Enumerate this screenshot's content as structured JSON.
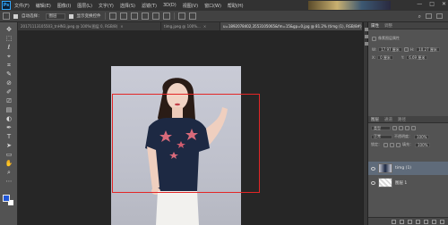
{
  "app": {
    "logo": "Ps"
  },
  "menu": {
    "items": [
      "文件(F)",
      "编辑(E)",
      "图像(I)",
      "图层(L)",
      "文字(Y)",
      "选择(S)",
      "滤镜(T)",
      "3D(D)",
      "视图(V)",
      "窗口(W)",
      "帮助(H)"
    ],
    "window_controls": [
      "—",
      "□",
      "✕"
    ]
  },
  "options": {
    "auto_select_label": "自动选择：",
    "auto_select_value": "图层",
    "show_transform_label": "显示变换控件",
    "search_icon": "search-icon"
  },
  "tabs": [
    {
      "label": "20171113105503_tnHN3.jpeg @ 100%(图层 0, RGB/8)",
      "close": "×"
    },
    {
      "label": "timg.jpeg @ 100%...",
      "close": "×"
    },
    {
      "label": "u=1892078402,3553105065&fm=15&gp=0.jpg @ 81.2% (timg (1), RGB/8#)",
      "close": "×",
      "active": true
    }
  ],
  "tools": [
    "✥",
    "⬚",
    "ℓ",
    "⌖",
    "⌗",
    "✎",
    "⊘",
    "✐",
    "⎚",
    "▤",
    "◐",
    "✒",
    "T",
    "➤",
    "▭",
    "✋",
    "⌕",
    "⋯"
  ],
  "colors": {
    "foreground": "#1f55d6",
    "background": "#ffffff",
    "selection": "#e32626",
    "accent": "#31a8ff"
  },
  "properties": {
    "tabs": [
      "属性",
      "调整"
    ],
    "section_title": "像素图层属性",
    "w_label": "W:",
    "w_value": "17.97 厘米",
    "h_label": "H:",
    "h_value": "10.27 厘米",
    "x_label": "X:",
    "x_value": "0 厘米",
    "y_label": "Y:",
    "y_value": "6.69 厘米"
  },
  "layers": {
    "tabs": [
      "图层",
      "通道",
      "路径"
    ],
    "filter_label": "类型",
    "blend_mode": "正常",
    "opacity_label": "不透明度：",
    "opacity_value": "100%",
    "lock_label": "锁定：",
    "fill_label": "填充：",
    "fill_value": "100%",
    "items": [
      {
        "name": "timg (1)",
        "selected": true
      },
      {
        "name": "图层 1",
        "selected": false
      }
    ]
  }
}
